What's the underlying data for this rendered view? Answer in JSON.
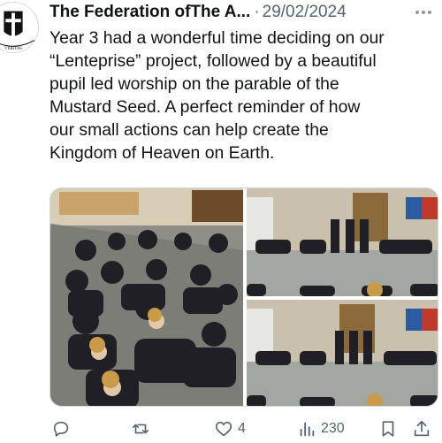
{
  "tweet": {
    "author": "The Federation ofThe A...",
    "separator": "·",
    "date": "29/02/2024",
    "avatar_label": "VERITAS",
    "text": "Year 3 had a wonderful time deciding on our\n“Lenteprise” project, followed by a beautiful\npupil led worship on the parable of the\nMustard Seed. A perfect reminder of how\nour small actions can help create the\nKingdom of Heaven on Earth."
  },
  "media": {
    "photos": [
      {
        "alt_name": "children-seated-on-floor-photo"
      },
      {
        "alt_name": "pupil-led-worship-photo"
      },
      {
        "alt_name": "pupil-led-worship-photo-2"
      }
    ]
  },
  "actions": {
    "reply_icon": "reply-icon",
    "retweet_icon": "retweet-icon",
    "like_icon": "heart-icon",
    "like_count": "4",
    "views_icon": "views-icon",
    "views_count": "230",
    "bookmark_icon": "bookmark-icon",
    "share_icon": "share-icon"
  },
  "colors": {
    "text": "#0f1419",
    "secondary": "#536471",
    "border": "#cfd9de"
  }
}
